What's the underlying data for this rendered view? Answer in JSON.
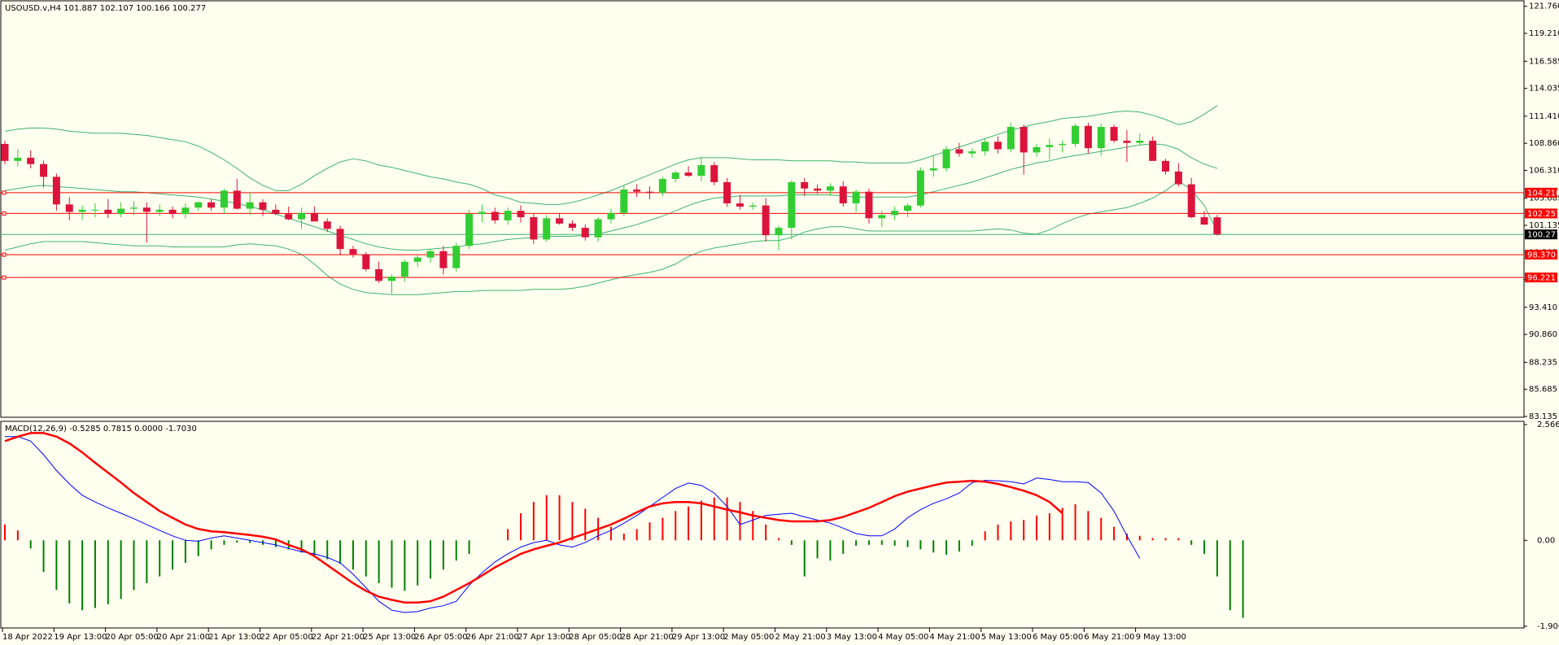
{
  "title": "USOUSD.v,H4  101.887 102.107 100.166 100.277",
  "macd_title": "MACD(12,26,9) -0.5285 0.7815 0.0000 -1.7030",
  "colors": {
    "background": "#FFFFF0",
    "bull": "#32CD32",
    "bear": "#DC143C",
    "band": "#3CB371",
    "hline": "#FF0000",
    "label_bg": "#FF0000",
    "price_label_bg": "#000000",
    "macd_pos": "#FF0000",
    "macd_neg": "#008000",
    "macd_line": "#0000FF",
    "signal_line": "#FF0000"
  },
  "chart_data": [
    {
      "type": "candlestick",
      "symbol": "USOUSD.v",
      "timeframe": "H4",
      "ylim": [
        83.135,
        122.2
      ],
      "y_ticks": [
        "121.760",
        "119.210",
        "116.585",
        "114.035",
        "111.410",
        "108.860",
        "106.310",
        "103.685",
        "101.135",
        "98.585",
        "96.035",
        "93.410",
        "90.860",
        "88.235",
        "85.685",
        "83.135"
      ],
      "x_labels": [
        "18 Apr 2022",
        "19 Apr 13:00",
        "20 Apr 05:00",
        "20 Apr 21:00",
        "21 Apr 13:00",
        "22 Apr 05:00",
        "22 Apr 21:00",
        "25 Apr 13:00",
        "26 Apr 05:00",
        "26 Apr 21:00",
        "27 Apr 13:00",
        "28 Apr 05:00",
        "28 Apr 21:00",
        "29 Apr 13:00",
        "2 May 05:00",
        "2 May 21:00",
        "3 May 13:00",
        "4 May 05:00",
        "4 May 21:00",
        "5 May 13:00",
        "6 May 05:00",
        "6 May 21:00",
        "9 May 13:00"
      ],
      "ohlc": [
        [
          108.8,
          109.1,
          106.9,
          107.2
        ],
        [
          107.2,
          108.3,
          106.7,
          107.5
        ],
        [
          107.5,
          108.2,
          106.5,
          106.9
        ],
        [
          106.9,
          107.2,
          104.7,
          105.7
        ],
        [
          105.7,
          106.0,
          102.5,
          103.1
        ],
        [
          103.1,
          103.8,
          101.6,
          102.4
        ],
        [
          102.4,
          103.0,
          101.6,
          102.6
        ],
        [
          102.6,
          103.2,
          101.9,
          102.6
        ],
        [
          102.6,
          103.6,
          101.8,
          102.2
        ],
        [
          102.2,
          103.3,
          101.9,
          102.7
        ],
        [
          102.7,
          103.4,
          102.1,
          102.8
        ],
        [
          102.8,
          103.3,
          99.5,
          102.4
        ],
        [
          102.4,
          103.1,
          102.0,
          102.6
        ],
        [
          102.6,
          102.9,
          101.8,
          102.2
        ],
        [
          102.2,
          103.2,
          101.8,
          102.8
        ],
        [
          102.8,
          103.4,
          102.5,
          103.3
        ],
        [
          103.3,
          103.6,
          102.5,
          102.8
        ],
        [
          102.8,
          104.6,
          102.2,
          104.4
        ],
        [
          104.4,
          105.5,
          102.6,
          102.7
        ],
        [
          102.7,
          104.3,
          102.1,
          103.3
        ],
        [
          103.3,
          103.6,
          102.0,
          102.6
        ],
        [
          102.6,
          103.1,
          102.1,
          102.2
        ],
        [
          102.2,
          102.9,
          101.6,
          101.7
        ],
        [
          101.7,
          102.8,
          100.8,
          102.3
        ],
        [
          102.3,
          102.9,
          101.5,
          101.5
        ],
        [
          101.5,
          101.8,
          100.5,
          100.8
        ],
        [
          100.8,
          101.1,
          98.3,
          98.9
        ],
        [
          98.9,
          99.2,
          98.1,
          98.4
        ],
        [
          98.4,
          98.6,
          96.8,
          97.0
        ],
        [
          97.0,
          97.7,
          95.7,
          95.9
        ],
        [
          95.9,
          96.5,
          94.7,
          96.3
        ],
        [
          96.3,
          97.9,
          95.8,
          97.7
        ],
        [
          97.7,
          98.3,
          97.2,
          98.1
        ],
        [
          98.1,
          98.9,
          97.6,
          98.7
        ],
        [
          98.7,
          99.2,
          96.5,
          97.1
        ],
        [
          97.1,
          99.5,
          96.8,
          99.2
        ],
        [
          99.2,
          102.6,
          98.9,
          102.2
        ],
        [
          102.2,
          103.1,
          101.4,
          102.4
        ],
        [
          102.4,
          102.8,
          101.3,
          101.6
        ],
        [
          101.6,
          102.8,
          101.2,
          102.5
        ],
        [
          102.5,
          103.0,
          101.4,
          101.9
        ],
        [
          101.9,
          102.3,
          99.4,
          99.8
        ],
        [
          99.8,
          102.1,
          99.6,
          101.8
        ],
        [
          101.8,
          102.3,
          101.2,
          101.3
        ],
        [
          101.3,
          101.6,
          100.6,
          100.9
        ],
        [
          100.9,
          101.2,
          99.7,
          100.0
        ],
        [
          100.0,
          101.9,
          99.6,
          101.7
        ],
        [
          101.7,
          102.7,
          101.3,
          102.3
        ],
        [
          102.3,
          104.9,
          102.0,
          104.5
        ],
        [
          104.5,
          105.0,
          103.8,
          104.3
        ],
        [
          104.3,
          104.8,
          103.6,
          104.2
        ],
        [
          104.2,
          105.7,
          103.9,
          105.5
        ],
        [
          105.5,
          106.3,
          105.2,
          106.1
        ],
        [
          106.1,
          106.7,
          105.7,
          105.8
        ],
        [
          105.8,
          107.6,
          105.3,
          106.8
        ],
        [
          106.8,
          107.1,
          104.9,
          105.2
        ],
        [
          105.2,
          105.6,
          102.9,
          103.2
        ],
        [
          103.2,
          104.0,
          102.6,
          102.9
        ],
        [
          102.9,
          103.3,
          102.6,
          103.0
        ],
        [
          103.0,
          103.7,
          99.6,
          100.2
        ],
        [
          100.2,
          101.1,
          98.8,
          100.9
        ],
        [
          100.9,
          105.4,
          99.8,
          105.2
        ],
        [
          105.2,
          105.6,
          103.9,
          104.6
        ],
        [
          104.6,
          105.0,
          104.1,
          104.4
        ],
        [
          104.4,
          105.1,
          103.9,
          104.8
        ],
        [
          104.8,
          105.3,
          102.9,
          103.2
        ],
        [
          103.2,
          104.5,
          102.4,
          104.3
        ],
        [
          104.3,
          104.6,
          101.3,
          101.8
        ],
        [
          101.8,
          102.5,
          101.0,
          102.1
        ],
        [
          102.1,
          102.9,
          101.6,
          102.5
        ],
        [
          102.5,
          103.2,
          101.9,
          103.0
        ],
        [
          103.0,
          106.6,
          102.8,
          106.3
        ],
        [
          106.3,
          107.7,
          105.7,
          106.5
        ],
        [
          106.5,
          108.6,
          106.2,
          108.3
        ],
        [
          108.3,
          108.9,
          107.6,
          107.9
        ],
        [
          107.9,
          108.4,
          107.5,
          108.1
        ],
        [
          108.1,
          109.3,
          107.7,
          109.0
        ],
        [
          109.0,
          109.5,
          107.9,
          108.3
        ],
        [
          108.3,
          110.8,
          108.0,
          110.4
        ],
        [
          110.4,
          110.6,
          105.9,
          108.0
        ],
        [
          108.0,
          108.8,
          107.6,
          108.5
        ],
        [
          108.5,
          109.3,
          107.3,
          108.7
        ],
        [
          108.7,
          109.1,
          108.0,
          108.8
        ],
        [
          108.8,
          110.7,
          108.5,
          110.5
        ],
        [
          110.5,
          110.8,
          107.9,
          108.4
        ],
        [
          108.4,
          110.7,
          107.7,
          110.4
        ],
        [
          110.4,
          110.6,
          108.9,
          109.1
        ],
        [
          109.1,
          110.1,
          107.1,
          108.9
        ],
        [
          108.9,
          109.8,
          108.7,
          109.1
        ],
        [
          109.1,
          109.5,
          107.9,
          107.2
        ],
        [
          107.2,
          107.4,
          105.9,
          106.2
        ],
        [
          106.2,
          107.0,
          104.8,
          105.0
        ],
        [
          105.0,
          105.6,
          101.8,
          101.9
        ],
        [
          101.9,
          102.5,
          101.2,
          101.2
        ],
        [
          101.887,
          102.107,
          100.166,
          100.277
        ]
      ],
      "bollinger": {
        "upper": [
          110.0,
          110.2,
          110.3,
          110.3,
          110.2,
          110.0,
          109.9,
          109.8,
          109.8,
          109.8,
          109.7,
          109.6,
          109.4,
          109.2,
          109.0,
          108.6,
          108.0,
          107.3,
          106.5,
          105.6,
          104.9,
          104.4,
          104.4,
          105.0,
          105.8,
          106.5,
          107.1,
          107.4,
          107.2,
          106.8,
          106.6,
          106.3,
          106.0,
          105.7,
          105.5,
          105.2,
          105.0,
          104.6,
          104.0,
          103.7,
          103.3,
          103.2,
          103.1,
          103.1,
          103.3,
          103.6,
          104.0,
          104.4,
          104.9,
          105.4,
          105.9,
          106.4,
          106.9,
          107.3,
          107.5,
          107.5,
          107.5,
          107.4,
          107.3,
          107.3,
          107.3,
          107.2,
          107.2,
          107.2,
          107.2,
          107.1,
          107.1,
          107.0,
          107.0,
          107.0,
          107.0,
          107.3,
          107.7,
          108.1,
          108.5,
          108.9,
          109.3,
          109.7,
          110.1,
          110.4,
          110.7,
          110.9,
          111.2,
          111.3,
          111.4,
          111.6,
          111.8,
          111.9,
          111.8,
          111.5,
          111.1,
          110.6,
          110.9,
          111.6,
          112.4
        ],
        "middle": [
          104.4,
          104.6,
          104.8,
          104.9,
          104.8,
          104.7,
          104.6,
          104.5,
          104.4,
          104.3,
          104.3,
          104.2,
          104.1,
          104.0,
          103.9,
          103.8,
          103.6,
          103.4,
          103.2,
          102.9,
          102.6,
          102.2,
          101.8,
          101.4,
          101.0,
          100.6,
          100.2,
          99.8,
          99.4,
          99.1,
          98.9,
          98.8,
          98.8,
          98.9,
          99.0,
          99.1,
          99.3,
          99.4,
          99.6,
          99.8,
          99.9,
          100.0,
          100.1,
          100.1,
          100.1,
          100.2,
          100.3,
          100.6,
          100.9,
          101.2,
          101.6,
          102.0,
          102.5,
          103.0,
          103.4,
          103.7,
          103.8,
          103.9,
          103.9,
          103.9,
          103.9,
          104.0,
          104.0,
          104.0,
          104.0,
          103.9,
          103.8,
          103.8,
          103.8,
          103.8,
          103.8,
          104.0,
          104.3,
          104.6,
          104.9,
          105.2,
          105.6,
          106.0,
          106.4,
          106.7,
          107.0,
          107.2,
          107.5,
          107.7,
          107.9,
          108.1,
          108.3,
          108.5,
          108.7,
          108.8,
          108.7,
          108.3,
          107.5,
          106.9,
          106.5
        ],
        "lower": [
          98.8,
          99.1,
          99.4,
          99.6,
          99.6,
          99.6,
          99.6,
          99.5,
          99.4,
          99.3,
          99.2,
          99.2,
          99.2,
          99.1,
          99.1,
          99.1,
          99.1,
          99.1,
          99.3,
          99.4,
          99.3,
          99.2,
          98.9,
          98.4,
          97.5,
          96.4,
          95.6,
          95.1,
          94.8,
          94.7,
          94.6,
          94.6,
          94.6,
          94.7,
          94.8,
          94.9,
          94.9,
          95.0,
          95.0,
          95.0,
          95.0,
          95.1,
          95.1,
          95.1,
          95.2,
          95.4,
          95.7,
          96.0,
          96.3,
          96.5,
          96.7,
          97.0,
          97.5,
          98.2,
          98.7,
          99.0,
          99.2,
          99.4,
          99.6,
          99.7,
          99.7,
          100.0,
          100.5,
          100.8,
          101.0,
          101.0,
          100.8,
          100.6,
          100.6,
          100.6,
          100.6,
          100.6,
          100.6,
          100.6,
          100.6,
          100.6,
          100.7,
          100.8,
          100.7,
          100.4,
          100.3,
          100.7,
          101.3,
          101.8,
          102.2,
          102.4,
          102.6,
          102.8,
          103.2,
          103.7,
          104.4,
          105.3,
          104.5,
          103.0,
          100.6
        ]
      },
      "horizontal_lines": [
        {
          "label": "104.210",
          "value": 104.21
        },
        {
          "label": "102.251",
          "value": 102.251
        },
        {
          "label": "98.370",
          "value": 98.37
        },
        {
          "label": "96.221",
          "value": 96.221
        }
      ],
      "price_line": {
        "label": "100.277",
        "value": 100.277
      }
    },
    {
      "type": "macd",
      "title": "MACD(12,26,9)",
      "ylim": [
        -1.9064,
        2.5669
      ],
      "y_ticks": [
        "2.5669",
        "0.00",
        "-1.9064"
      ],
      "tick_values": [
        2.5669,
        0,
        -1.9064
      ],
      "histogram": [
        0.35,
        0.22,
        -0.18,
        -0.7,
        -1.1,
        -1.4,
        -1.55,
        -1.5,
        -1.42,
        -1.3,
        -1.1,
        -0.95,
        -0.8,
        -0.65,
        -0.5,
        -0.35,
        -0.2,
        -0.1,
        -0.05,
        -0.06,
        -0.1,
        -0.15,
        -0.2,
        -0.27,
        -0.34,
        -0.42,
        -0.52,
        -0.65,
        -0.8,
        -0.95,
        -1.05,
        -1.12,
        -1.0,
        -0.85,
        -0.65,
        -0.45,
        -0.3,
        0.0,
        0.0,
        0.25,
        0.6,
        0.85,
        1.0,
        1.0,
        0.85,
        0.7,
        0.5,
        0.3,
        0.15,
        0.25,
        0.4,
        0.5,
        0.65,
        0.75,
        0.88,
        0.95,
        0.95,
        0.85,
        0.65,
        0.35,
        0.05,
        -0.1,
        -0.8,
        -0.4,
        -0.45,
        -0.3,
        -0.12,
        -0.1,
        -0.1,
        -0.12,
        -0.15,
        -0.2,
        -0.27,
        -0.32,
        -0.25,
        -0.12,
        0.2,
        0.35,
        0.42,
        0.45,
        0.55,
        0.6,
        0.72,
        0.8,
        0.65,
        0.5,
        0.3,
        0.15,
        0.1,
        0.05,
        0.05,
        0.05,
        -0.1,
        -0.3,
        -0.8,
        -1.55,
        -1.72
      ],
      "macd_line": [
        2.3,
        2.3,
        2.2,
        1.9,
        1.55,
        1.25,
        1.0,
        0.85,
        0.72,
        0.6,
        0.48,
        0.35,
        0.22,
        0.1,
        0.0,
        -0.02,
        0.05,
        0.1,
        0.05,
        0.0,
        -0.05,
        -0.1,
        -0.18,
        -0.25,
        -0.3,
        -0.38,
        -0.5,
        -0.75,
        -1.05,
        -1.35,
        -1.55,
        -1.6,
        -1.58,
        -1.5,
        -1.45,
        -1.35,
        -1.0,
        -0.72,
        -0.48,
        -0.3,
        -0.15,
        -0.05,
        0.0,
        -0.1,
        -0.15,
        -0.05,
        0.1,
        0.22,
        0.38,
        0.55,
        0.75,
        0.95,
        1.15,
        1.27,
        1.22,
        1.05,
        0.75,
        0.35,
        0.45,
        0.55,
        0.58,
        0.6,
        0.52,
        0.45,
        0.38,
        0.27,
        0.15,
        0.1,
        0.1,
        0.25,
        0.5,
        0.68,
        0.82,
        0.92,
        1.05,
        1.28,
        1.33,
        1.32,
        1.3,
        1.25,
        1.38,
        1.35,
        1.3,
        1.3,
        1.28,
        1.05,
        0.65,
        0.1,
        -0.4
      ],
      "signal_line": [
        2.2,
        2.3,
        2.38,
        2.38,
        2.3,
        2.15,
        1.95,
        1.72,
        1.5,
        1.28,
        1.05,
        0.85,
        0.65,
        0.5,
        0.35,
        0.25,
        0.2,
        0.18,
        0.15,
        0.12,
        0.08,
        0.02,
        -0.1,
        -0.2,
        -0.35,
        -0.55,
        -0.75,
        -0.95,
        -1.12,
        -1.25,
        -1.32,
        -1.38,
        -1.38,
        -1.35,
        -1.25,
        -1.1,
        -0.95,
        -0.78,
        -0.6,
        -0.45,
        -0.3,
        -0.2,
        -0.12,
        -0.05,
        0.05,
        0.15,
        0.25,
        0.35,
        0.48,
        0.62,
        0.75,
        0.82,
        0.85,
        0.85,
        0.82,
        0.75,
        0.68,
        0.62,
        0.55,
        0.5,
        0.45,
        0.42,
        0.42,
        0.42,
        0.45,
        0.52,
        0.62,
        0.72,
        0.85,
        0.98,
        1.08,
        1.15,
        1.22,
        1.28,
        1.3,
        1.32,
        1.3,
        1.25,
        1.18,
        1.1,
        1.0,
        0.85,
        0.6
      ]
    }
  ]
}
